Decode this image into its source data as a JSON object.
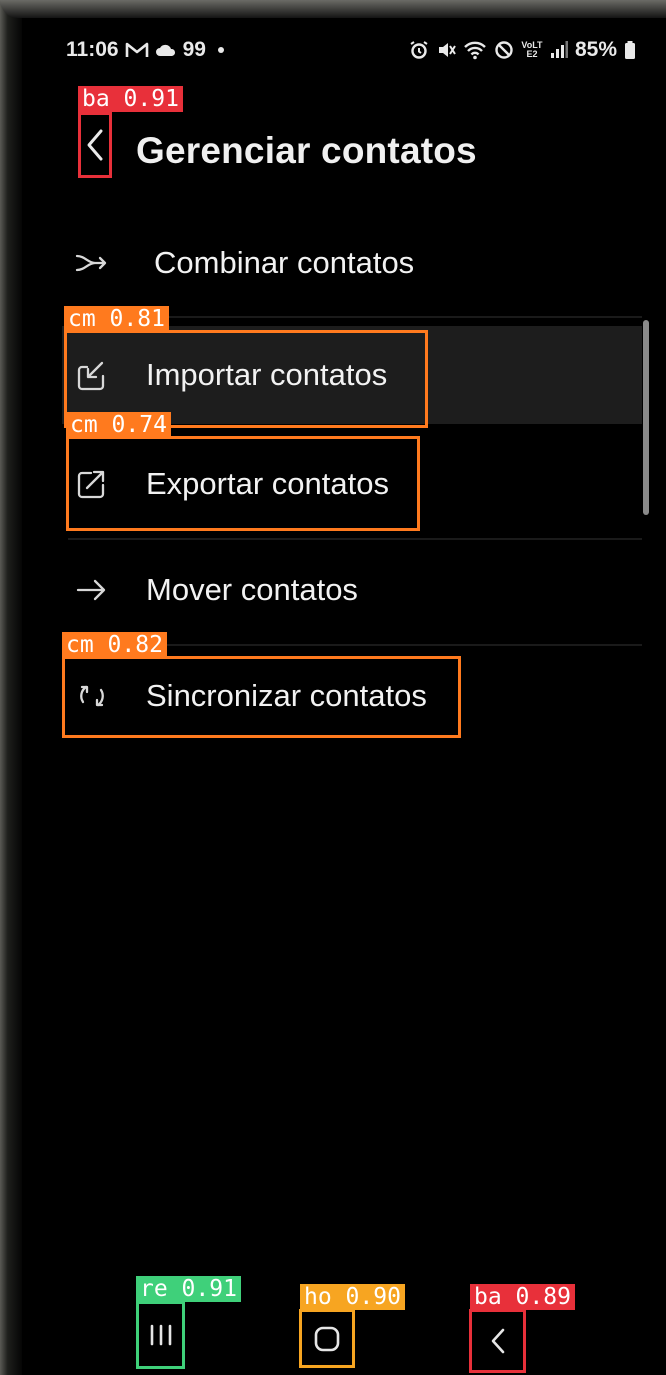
{
  "status_bar": {
    "time": "11:06",
    "battery": "85%",
    "notification_count": "99",
    "left_icons": [
      "gmail-icon",
      "cloud-icon"
    ],
    "right_icons": [
      "alarm-icon",
      "mute-icon",
      "wifi-icon",
      "dnd-icon",
      "volte-icon",
      "signal-icon",
      "battery-icon"
    ],
    "volte_text": "VoLTE2"
  },
  "header": {
    "title": "Gerenciar contatos",
    "back_icon": "chevron-left-icon"
  },
  "menu": {
    "items": [
      {
        "label": "Combinar contatos",
        "icon": "merge-arrow-icon"
      },
      {
        "label": "Importar contatos",
        "icon": "import-icon"
      },
      {
        "label": "Exportar contatos",
        "icon": "export-icon"
      },
      {
        "label": "Mover contatos",
        "icon": "arrow-right-icon"
      },
      {
        "label": "Sincronizar contatos",
        "icon": "sync-icon"
      }
    ]
  },
  "detections": {
    "back_top": "ba  0.91",
    "import": "cm  0.81",
    "export": "cm  0.74",
    "sync": "cm  0.82",
    "recents": "re  0.91",
    "home": "ho  0.90",
    "back_nav": "ba  0.89"
  },
  "colors": {
    "background": "#000000",
    "text": "#f2f2f2",
    "box_orange": "#ff7a1e",
    "box_red": "#e8303a",
    "box_green": "#3fd07a",
    "box_amber": "#f7a521"
  }
}
